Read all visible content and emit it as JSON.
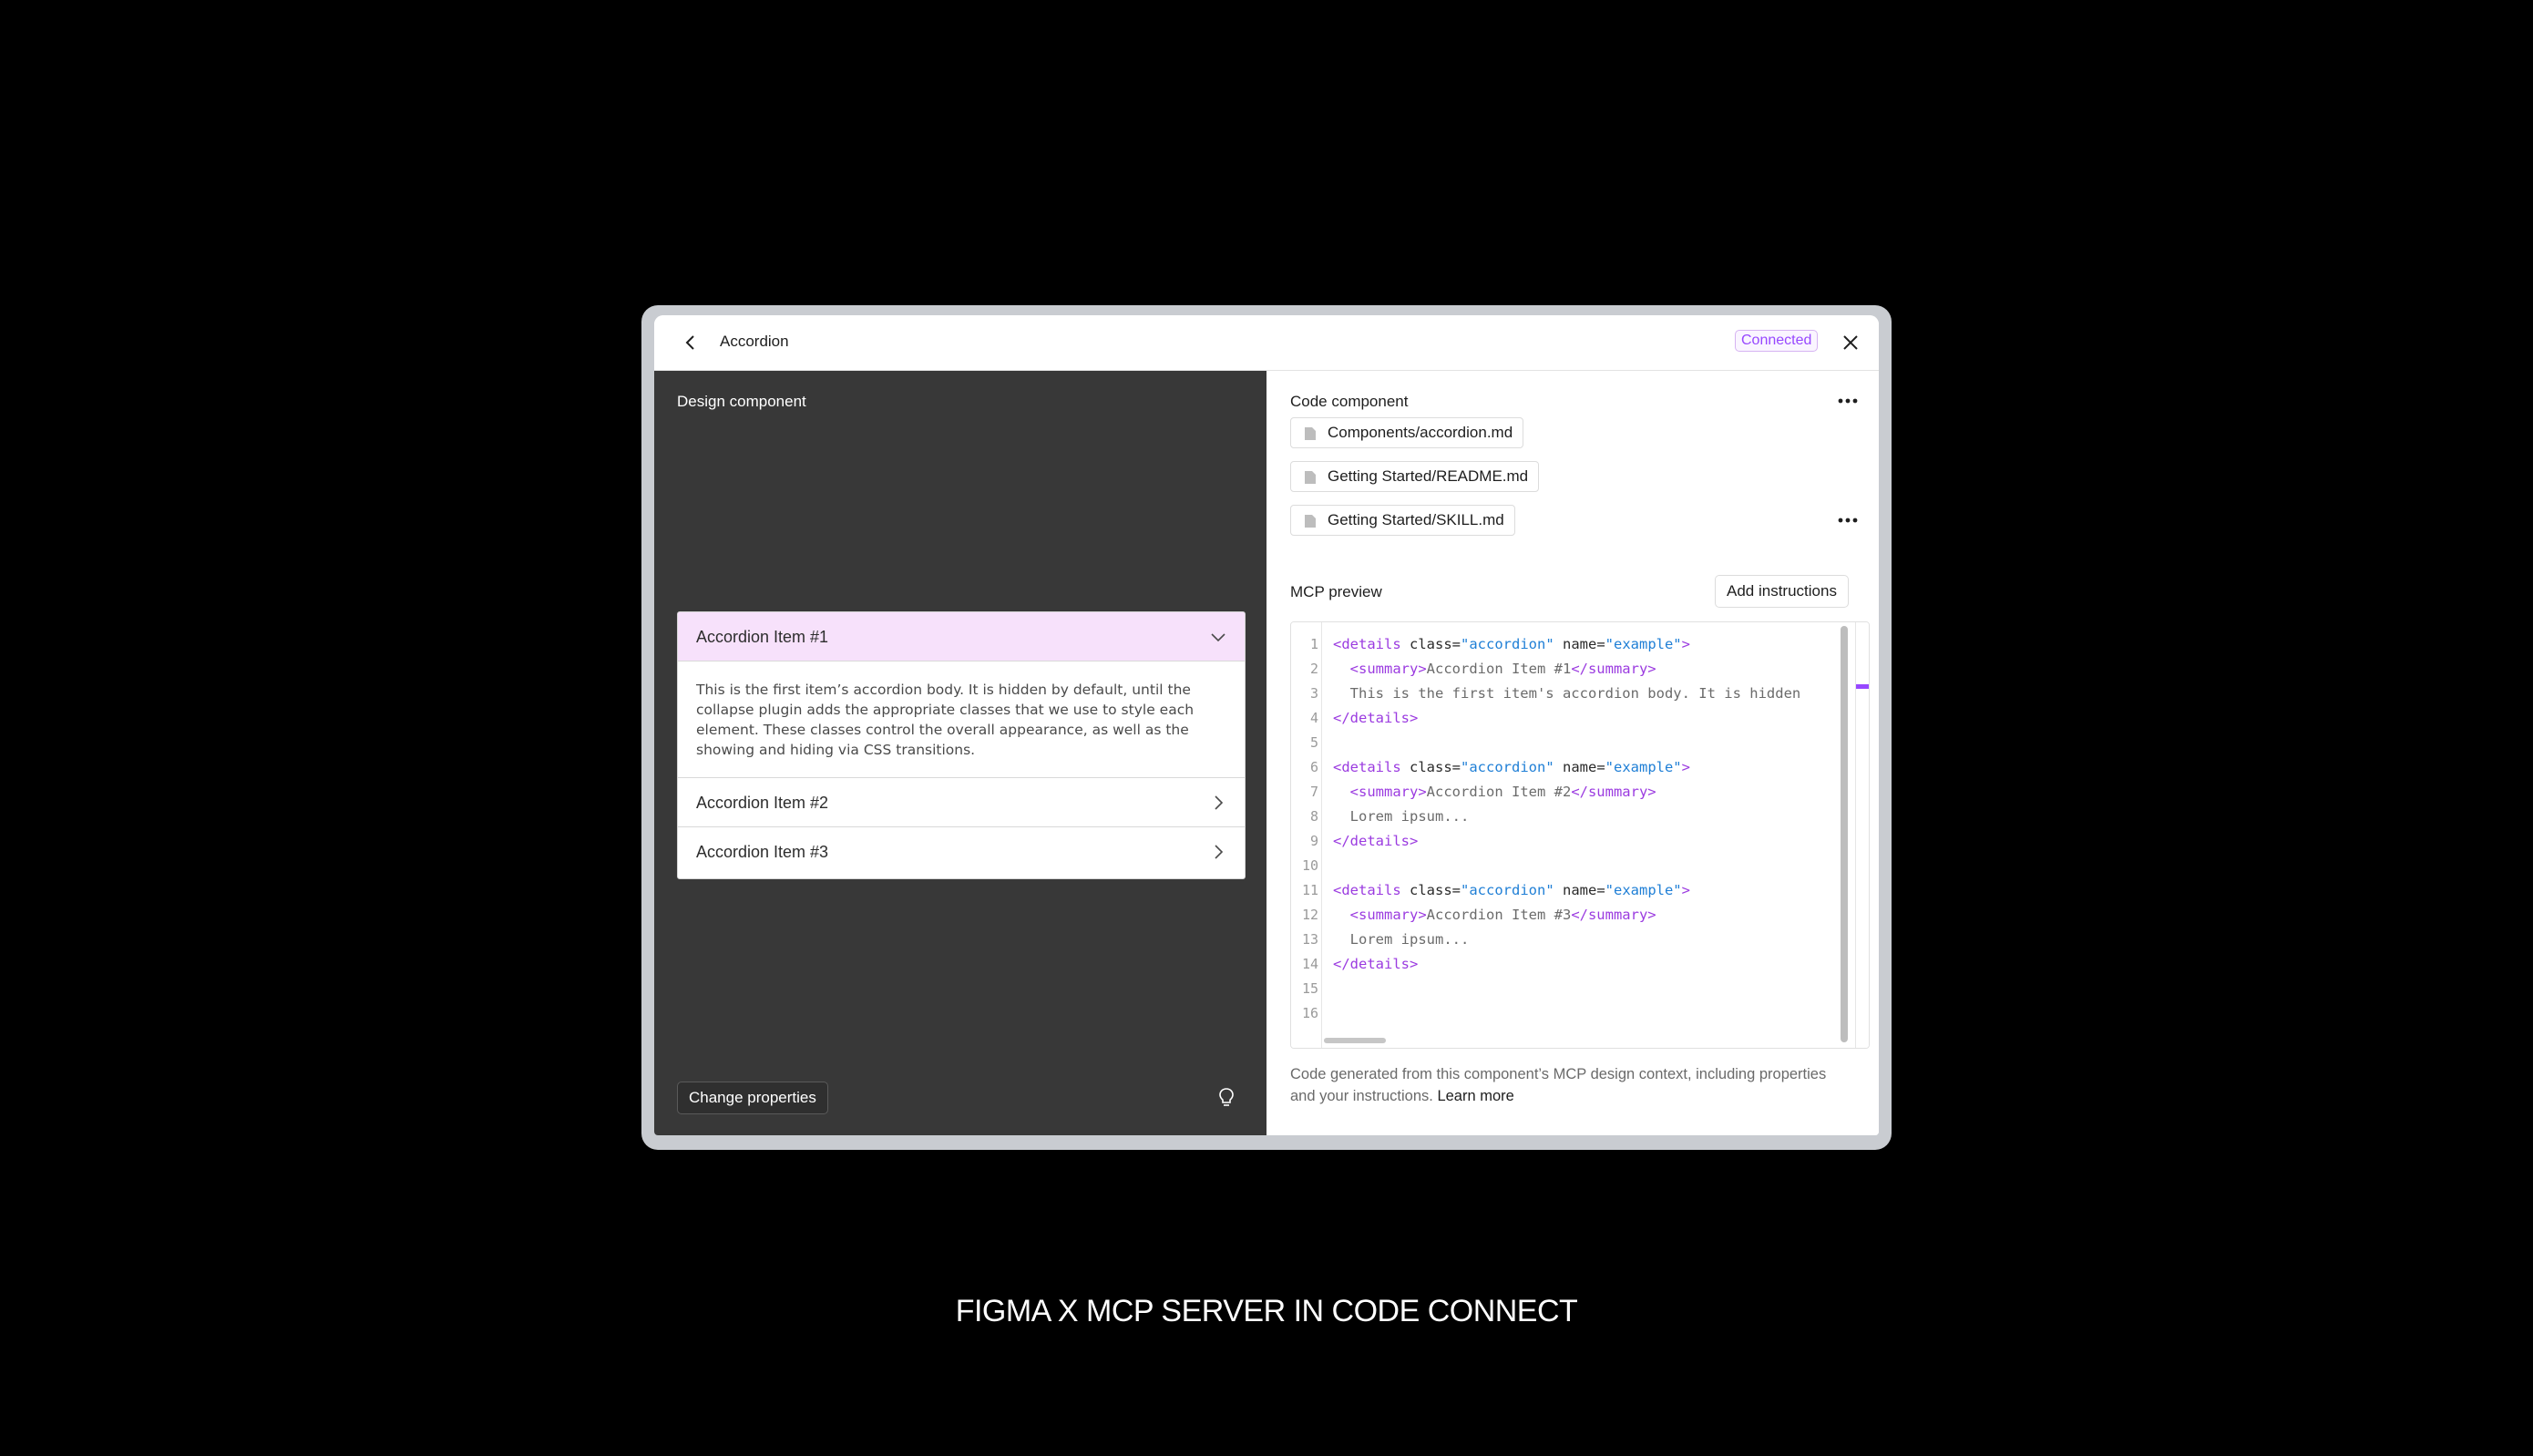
{
  "window": {
    "title": "Accordion",
    "status_badge": "Connected",
    "accent_color": "#9747ff"
  },
  "design_panel": {
    "title": "Design component",
    "accordion": {
      "item1_label": "Accordion Item #1",
      "item1_body": "This is the first item’s accordion body. It is hidden by default, until the collapse plugin adds the appropriate classes that we use to style each element. These classes control the overall appearance, as well as the showing and hiding via CSS transitions.",
      "item2_label": "Accordion Item #2",
      "item3_label": "Accordion Item #3"
    },
    "change_properties_label": "Change properties",
    "icons": {
      "back": "chevron-left-icon",
      "close": "close-icon",
      "hint": "lightbulb-icon"
    }
  },
  "code_panel": {
    "title": "Code component",
    "files": [
      "Components/accordion.md",
      "Getting Started/README.md",
      "Getting Started/SKILL.md"
    ],
    "mcp_preview_label": "MCP preview",
    "add_instructions_label": "Add instructions",
    "code_lines": {
      "n": [
        "1",
        "2",
        "3",
        "4",
        "5",
        "6",
        "7",
        "8",
        "9",
        "10",
        "11",
        "12",
        "13",
        "14",
        "15",
        "16"
      ],
      "summary1": "Accordion Item #1",
      "body1": "This is the first item's accordion body. It is hidden",
      "summary2": "Accordion Item #2",
      "summary3": "Accordion Item #3",
      "lorem": "Lorem ipsum...",
      "details_class": "\"accordion\"",
      "details_name": "\"example\""
    },
    "footer_note": "Code generated from this component’s MCP design context, including properties and your instructions.",
    "learn_more": "Learn more"
  },
  "caption": "FIGMA X MCP SERVER IN CODE CONNECT"
}
